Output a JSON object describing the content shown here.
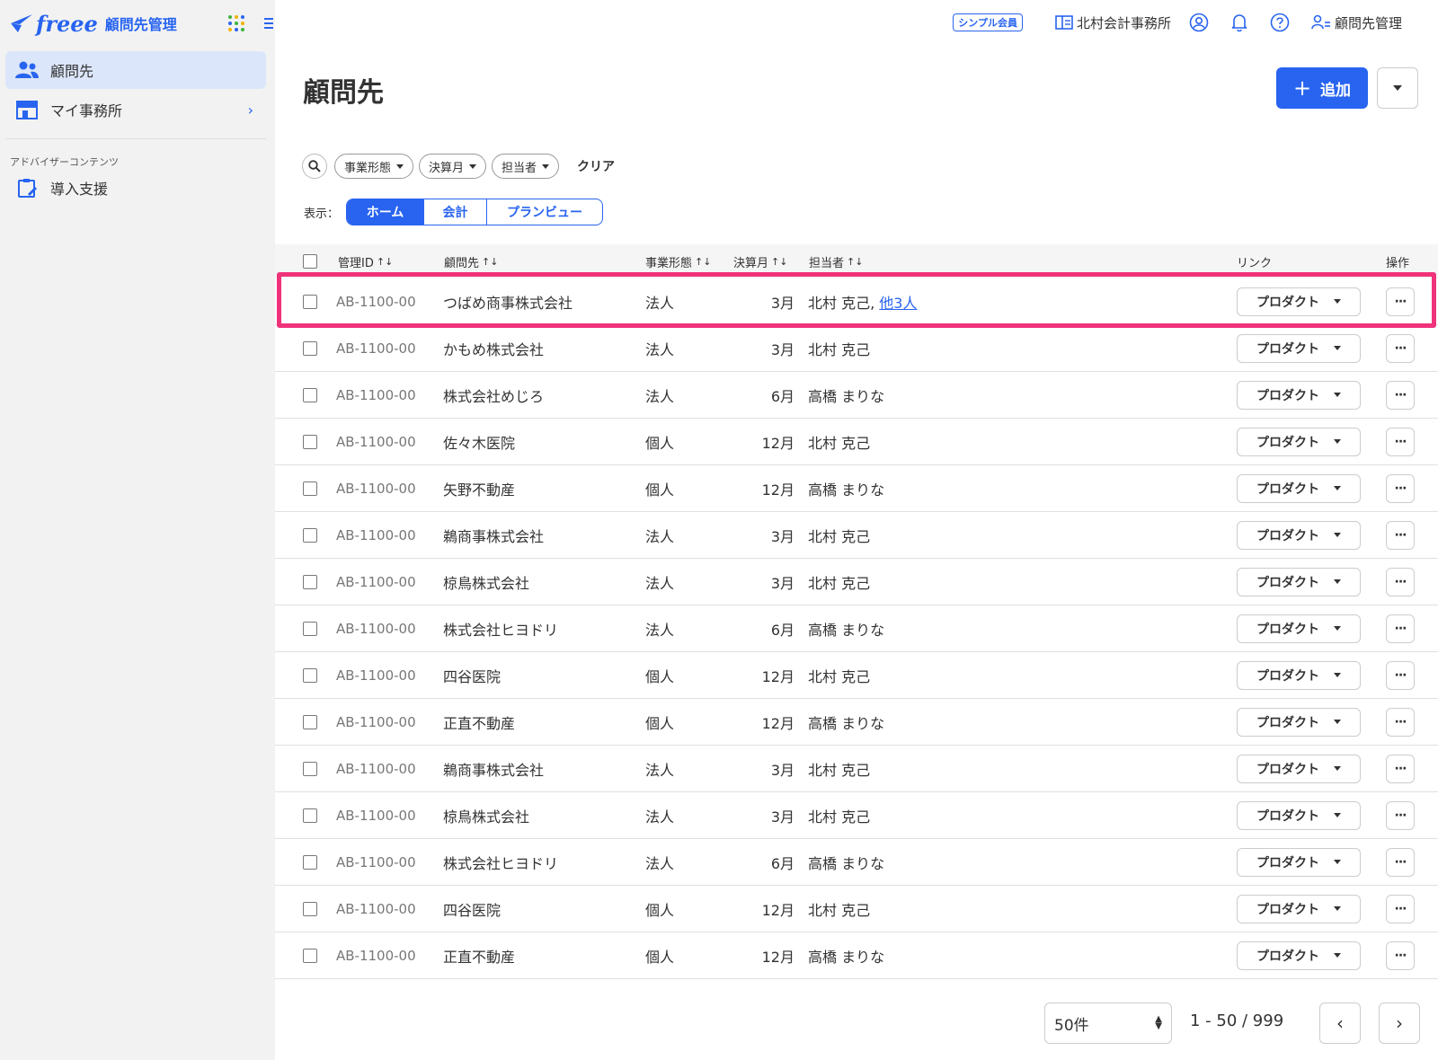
{
  "app": {
    "brand": "freee",
    "product": "顧問先管理"
  },
  "colors": {
    "accent": "#2864f0",
    "highlight": "#f0327a"
  },
  "sidebar": {
    "items": [
      {
        "label": "顧問先",
        "icon": "users-icon",
        "active": true
      },
      {
        "label": "マイ事務所",
        "icon": "office-icon",
        "active": false
      }
    ],
    "section_caption": "アドバイザーコンテンツ",
    "section_items": [
      {
        "label": "導入支援",
        "icon": "clipboard-edit-icon"
      }
    ]
  },
  "header": {
    "plan_badge": "シンプル会員",
    "office_name": "北村会計事務所",
    "user_menu": "顧問先管理"
  },
  "main": {
    "title": "顧問先",
    "add_label": "追加",
    "filters": [
      "事業形態",
      "決算月",
      "担当者"
    ],
    "clear_label": "クリア",
    "view_label": "表示：",
    "views": [
      {
        "label": "ホーム",
        "selected": true
      },
      {
        "label": "会計",
        "selected": false
      },
      {
        "label": "プランビュー",
        "selected": false
      }
    ]
  },
  "table": {
    "headers": {
      "id": "管理ID",
      "name": "顧問先",
      "type": "事業形態",
      "month": "決算月",
      "owner": "担当者",
      "link": "リンク",
      "ops": "操作"
    },
    "product_label": "プロダクト",
    "more_label": "···",
    "rows": [
      {
        "id": "AB-1100-00",
        "name": "つばめ商事株式会社",
        "type": "法人",
        "month": "3月",
        "owner": "北村 克己,",
        "extra": "他3人"
      },
      {
        "id": "AB-1100-00",
        "name": "かもめ株式会社",
        "type": "法人",
        "month": "3月",
        "owner": "北村 克己"
      },
      {
        "id": "AB-1100-00",
        "name": "株式会社めじろ",
        "type": "法人",
        "month": "6月",
        "owner": "高橋 まりな"
      },
      {
        "id": "AB-1100-00",
        "name": "佐々木医院",
        "type": "個人",
        "month": "12月",
        "owner": "北村 克己"
      },
      {
        "id": "AB-1100-00",
        "name": "矢野不動産",
        "type": "個人",
        "month": "12月",
        "owner": "高橋 まりな"
      },
      {
        "id": "AB-1100-00",
        "name": "鵜商事株式会社",
        "type": "法人",
        "month": "3月",
        "owner": "北村 克己"
      },
      {
        "id": "AB-1100-00",
        "name": "椋鳥株式会社",
        "type": "法人",
        "month": "3月",
        "owner": "北村 克己"
      },
      {
        "id": "AB-1100-00",
        "name": "株式会社ヒヨドリ",
        "type": "法人",
        "month": "6月",
        "owner": "高橋 まりな"
      },
      {
        "id": "AB-1100-00",
        "name": "四谷医院",
        "type": "個人",
        "month": "12月",
        "owner": "北村 克己"
      },
      {
        "id": "AB-1100-00",
        "name": "正直不動産",
        "type": "個人",
        "month": "12月",
        "owner": "高橋 まりな"
      },
      {
        "id": "AB-1100-00",
        "name": "鵜商事株式会社",
        "type": "法人",
        "month": "3月",
        "owner": "北村 克己"
      },
      {
        "id": "AB-1100-00",
        "name": "椋鳥株式会社",
        "type": "法人",
        "month": "3月",
        "owner": "北村 克己"
      },
      {
        "id": "AB-1100-00",
        "name": "株式会社ヒヨドリ",
        "type": "法人",
        "month": "6月",
        "owner": "高橋 まりな"
      },
      {
        "id": "AB-1100-00",
        "name": "四谷医院",
        "type": "個人",
        "month": "12月",
        "owner": "北村 克己"
      },
      {
        "id": "AB-1100-00",
        "name": "正直不動産",
        "type": "個人",
        "month": "12月",
        "owner": "高橋 まりな"
      }
    ]
  },
  "pagination": {
    "per_page": "50件",
    "range": "1 - 50 / 999",
    "prev_icon": "chevron-left-icon",
    "next_icon": "chevron-right-icon"
  }
}
